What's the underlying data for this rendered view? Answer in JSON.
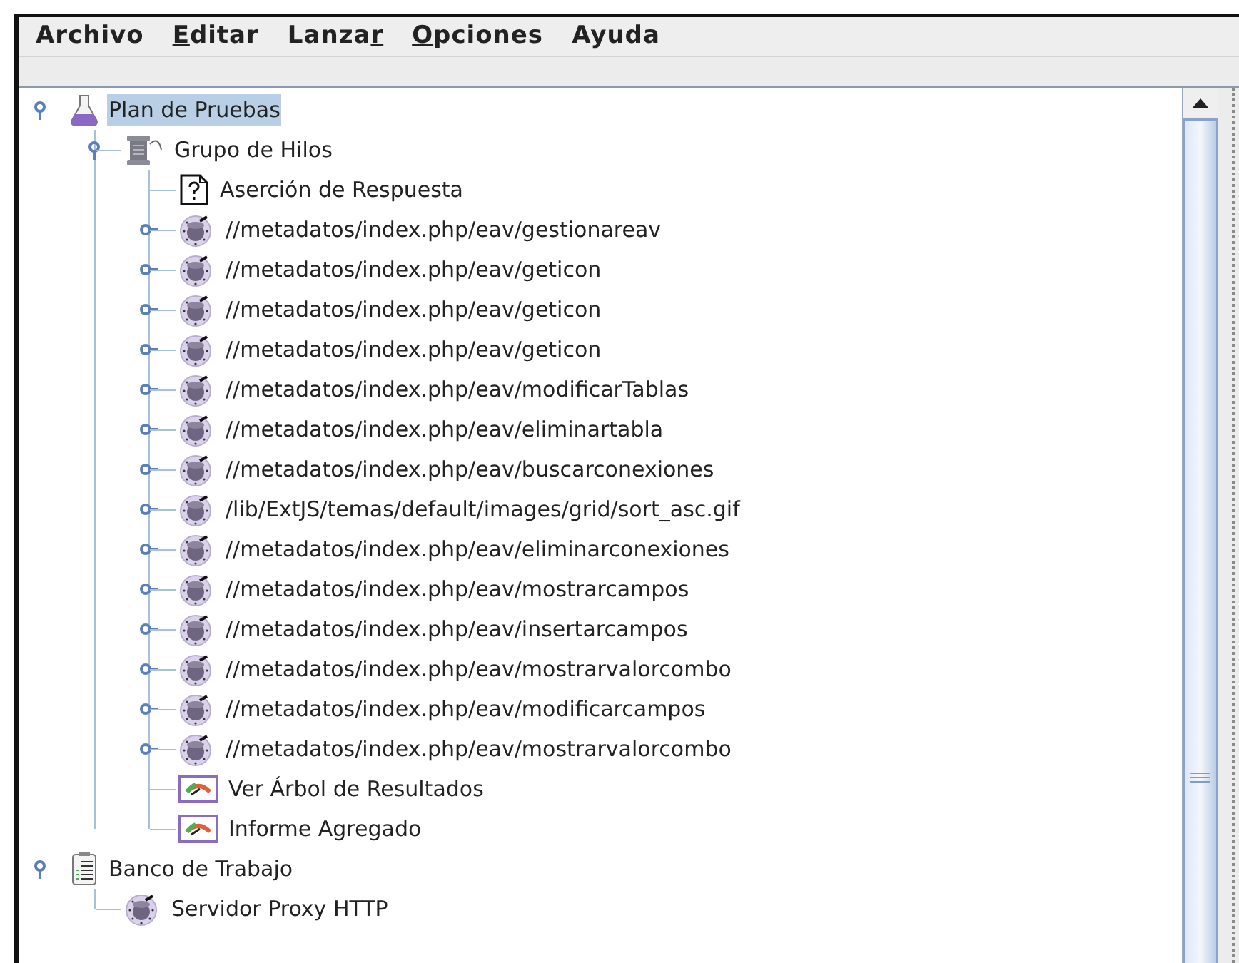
{
  "menu": [
    {
      "before": "Archivo"
    },
    {
      "key": "E",
      "after": "ditar"
    },
    {
      "before": "Lanza",
      "key": "r"
    },
    {
      "key": "O",
      "after": "pciones"
    },
    {
      "before": "Ayuda"
    }
  ],
  "tree": [
    {
      "label": "Plan de Pruebas",
      "kind": "plan",
      "selected": true,
      "expanded": true,
      "children": [
        {
          "label": "Grupo de Hilos",
          "kind": "threads",
          "selected": false,
          "expanded": true,
          "children": [
            {
              "label": "Aserción de Respuesta",
              "kind": "assertion",
              "selected": false
            },
            {
              "label": "//metadatos/index.php/eav/gestionareav",
              "kind": "sampler",
              "selected": false,
              "expanded": false
            },
            {
              "label": "//metadatos/index.php/eav/geticon",
              "kind": "sampler",
              "selected": false,
              "expanded": false
            },
            {
              "label": "//metadatos/index.php/eav/geticon",
              "kind": "sampler",
              "selected": false,
              "expanded": false
            },
            {
              "label": "//metadatos/index.php/eav/geticon",
              "kind": "sampler",
              "selected": false,
              "expanded": false
            },
            {
              "label": "//metadatos/index.php/eav/modificarTablas",
              "kind": "sampler",
              "selected": false,
              "expanded": false
            },
            {
              "label": "//metadatos/index.php/eav/eliminartabla",
              "kind": "sampler",
              "selected": false,
              "expanded": false
            },
            {
              "label": "//metadatos/index.php/eav/buscarconexiones",
              "kind": "sampler",
              "selected": false,
              "expanded": false
            },
            {
              "label": "/lib/ExtJS/temas/default/images/grid/sort_asc.gif",
              "kind": "sampler",
              "selected": false,
              "expanded": false
            },
            {
              "label": "//metadatos/index.php/eav/eliminarconexiones",
              "kind": "sampler",
              "selected": false,
              "expanded": false
            },
            {
              "label": "//metadatos/index.php/eav/mostrarcampos",
              "kind": "sampler",
              "selected": false,
              "expanded": false
            },
            {
              "label": "//metadatos/index.php/eav/insertarcampos",
              "kind": "sampler",
              "selected": false,
              "expanded": false
            },
            {
              "label": "//metadatos/index.php/eav/mostrarvalorcombo",
              "kind": "sampler",
              "selected": false,
              "expanded": false
            },
            {
              "label": "//metadatos/index.php/eav/modificarcampos",
              "kind": "sampler",
              "selected": false,
              "expanded": false
            },
            {
              "label": "//metadatos/index.php/eav/mostrarvalorcombo",
              "kind": "sampler",
              "selected": false,
              "expanded": false
            },
            {
              "label": "Ver Árbol de Resultados",
              "kind": "listener",
              "selected": false
            },
            {
              "label": "Informe Agregado",
              "kind": "listener",
              "selected": false
            }
          ]
        }
      ]
    },
    {
      "label": "Banco de Trabajo",
      "kind": "workbench",
      "selected": false,
      "expanded": true,
      "children": [
        {
          "label": "Servidor Proxy HTTP",
          "kind": "sampler",
          "selected": false
        }
      ]
    }
  ]
}
